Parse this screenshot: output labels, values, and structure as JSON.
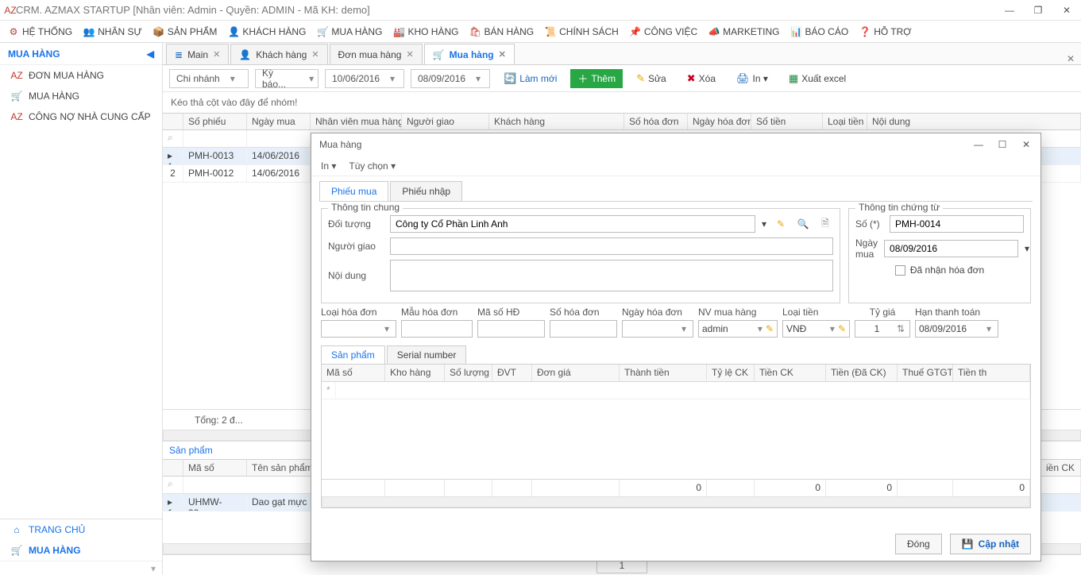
{
  "window": {
    "title": "CRM. AZMAX STARTUP [Nhân viên: Admin - Quyền: ADMIN - Mã KH: demo]"
  },
  "menubar": [
    "HỆ THỐNG",
    "NHÂN SỰ",
    "SẢN PHẨM",
    "KHÁCH HÀNG",
    "MUA HÀNG",
    "KHO HÀNG",
    "BÁN HÀNG",
    "CHÍNH SÁCH",
    "CÔNG VIỆC",
    "MARKETING",
    "BÁO CÁO",
    "HỖ TRỢ"
  ],
  "sidebar": {
    "title": "MUA HÀNG",
    "items": [
      "ĐƠN MUA HÀNG",
      "MUA HÀNG",
      "CÔNG NỢ NHÀ CUNG CẤP"
    ],
    "bottom": [
      "TRANG CHỦ",
      "MUA HÀNG"
    ]
  },
  "tabs": [
    {
      "label": "Main"
    },
    {
      "label": "Khách hàng"
    },
    {
      "label": "Đơn mua hàng"
    },
    {
      "label": "Mua hàng",
      "active": true
    }
  ],
  "toolbar": {
    "chinhanh": "Chi nhánh",
    "kybao": "Kỳ báo...",
    "from": "10/06/2016",
    "to": "08/09/2016",
    "refresh": "Làm mới",
    "add": "Thêm",
    "edit": "Sửa",
    "del": "Xóa",
    "print": "In ▾",
    "excel": "Xuất excel"
  },
  "grouphint": "Kéo thả cột vào đây để nhóm!",
  "grid": {
    "columns": [
      "",
      "Số phiếu",
      "Ngày mua",
      "Nhân viên mua hàng",
      "Người giao",
      "Khách hàng",
      "Số hóa đơn",
      "Ngày hóa đơn",
      "Số tiền",
      "Loại tiền",
      "Nội dung"
    ],
    "filtermark": "⌕",
    "rows": [
      {
        "n": "1",
        "so": "PMH-0013",
        "ngay": "14/06/2016"
      },
      {
        "n": "2",
        "so": "PMH-0012",
        "ngay": "14/06/2016"
      }
    ],
    "footer": "Tổng: 2 đ..."
  },
  "subgrid": {
    "title": "Sản phẩm",
    "columns": [
      "",
      "Mã số",
      "Tên sản phẩm"
    ],
    "row": {
      "n": "1",
      "ma": "UHMW-32x...",
      "ten": "Dao gạt mực m..."
    },
    "pager": "1"
  },
  "rightcols": [
    "iền CK"
  ],
  "dialog": {
    "title": "Mua hàng",
    "menu": [
      "In ▾",
      "Tùy chọn ▾"
    ],
    "tabs": [
      "Phiếu mua",
      "Phiếu nhập"
    ],
    "g1": {
      "title": "Thông tin chung",
      "doituong_label": "Đối tượng",
      "doituong": "Công ty Cổ Phần Linh Anh",
      "nguoigiao_label": "Người giao",
      "noidung_label": "Nội dung"
    },
    "g2": {
      "title": "Thông tin chứng từ",
      "so_label": "Số (*)",
      "so": "PMH-0014",
      "ngaymua_label": "Ngày mua",
      "ngaymua": "08/09/2016",
      "danhan": "Đã nhận hóa đơn"
    },
    "row2": {
      "loaihd": "Loại hóa đơn",
      "mauhd": "Mẫu hóa đơn",
      "masohd": "Mã số HĐ",
      "sohd": "Số hóa đơn",
      "ngayhd": "Ngày hóa đơn",
      "nvmua": "NV mua hàng",
      "nvmua_val": "admin",
      "loaitien": "Loại tiền",
      "loaitien_val": "VNĐ",
      "tygia": "Tỷ giá",
      "tygia_val": "1",
      "hantt": "Hạn thanh toán",
      "hantt_val": "08/09/2016"
    },
    "innertabs": [
      "Sản phẩm",
      "Serial number"
    ],
    "innercols": [
      "Mã số",
      "Kho hàng",
      "Số lượng",
      "ĐVT",
      "Đơn giá",
      "Thành tiền",
      "Tỷ lệ CK",
      "Tiền CK",
      "Tiền (Đã CK)",
      "Thuế GTGT",
      "Tiền th"
    ],
    "innerfooter": [
      "0",
      "0",
      "0",
      "0"
    ],
    "close": "Đóng",
    "save": "Cập nhật"
  }
}
